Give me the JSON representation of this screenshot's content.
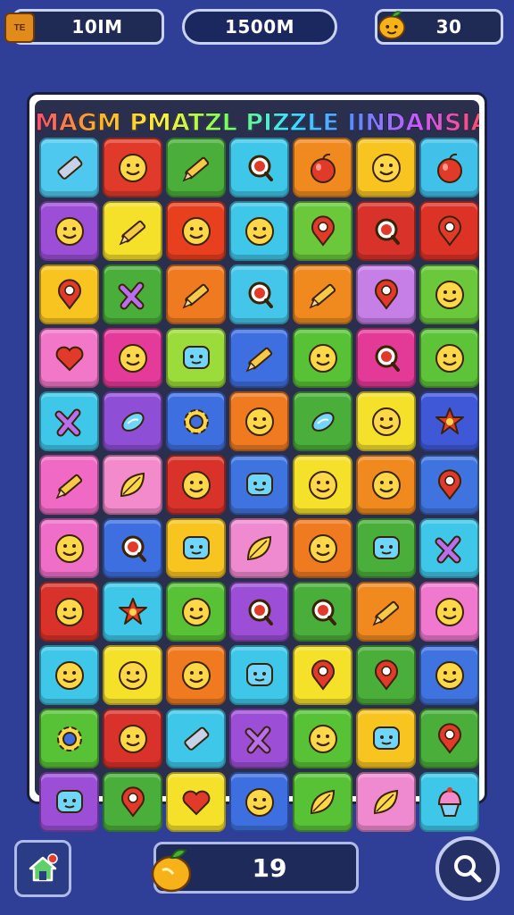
{
  "hud": {
    "left_value": "10IM",
    "center_value": "1500M",
    "right_value": "30",
    "chest_label": "TE",
    "left_icon": "treasure-chest-icon",
    "right_icon": "fruit-icon"
  },
  "board": {
    "title": "MAGM PMATZL PIZZLE IINDANSIA!",
    "tiles": [
      {
        "color": "#4fc8ef",
        "icon": "eraser"
      },
      {
        "color": "#e23a2a",
        "icon": "face"
      },
      {
        "color": "#4aae3a",
        "icon": "pencil"
      },
      {
        "color": "#3ec7e8",
        "icon": "search"
      },
      {
        "color": "#f08a1e",
        "icon": "apple"
      },
      {
        "color": "#f8c520",
        "icon": "face"
      },
      {
        "color": "#3fc1ea",
        "icon": "apple"
      },
      {
        "color": "#9c4fd6",
        "icon": "face"
      },
      {
        "color": "#f5e02a",
        "icon": "pencil"
      },
      {
        "color": "#e8401f",
        "icon": "face"
      },
      {
        "color": "#3ec7e8",
        "icon": "face"
      },
      {
        "color": "#6ac83a",
        "icon": "pin"
      },
      {
        "color": "#d8322a",
        "icon": "search"
      },
      {
        "color": "#dd3326",
        "icon": "pin"
      },
      {
        "color": "#f8c520",
        "icon": "pin"
      },
      {
        "color": "#4aae3a",
        "icon": "cross"
      },
      {
        "color": "#ef7a20",
        "icon": "pencil"
      },
      {
        "color": "#44c6ea",
        "icon": "search"
      },
      {
        "color": "#f08a1e",
        "icon": "pencil"
      },
      {
        "color": "#c77fe8",
        "icon": "pin"
      },
      {
        "color": "#6ac83a",
        "icon": "face"
      },
      {
        "color": "#f277c9",
        "icon": "heart"
      },
      {
        "color": "#e43a9a",
        "icon": "face"
      },
      {
        "color": "#9bdc3a",
        "icon": "bubble"
      },
      {
        "color": "#3e6fe0",
        "icon": "pencil"
      },
      {
        "color": "#58c236",
        "icon": "face"
      },
      {
        "color": "#e33a98",
        "icon": "search"
      },
      {
        "color": "#5dc43a",
        "icon": "face"
      },
      {
        "color": "#3ec7e8",
        "icon": "cross"
      },
      {
        "color": "#8e4fd6",
        "icon": "candy"
      },
      {
        "color": "#3e6fe0",
        "icon": "gear"
      },
      {
        "color": "#ef7a20",
        "icon": "face"
      },
      {
        "color": "#4aae3a",
        "icon": "candy"
      },
      {
        "color": "#f5e02a",
        "icon": "face"
      },
      {
        "color": "#3f58d8",
        "icon": "star"
      },
      {
        "color": "#f06ac5",
        "icon": "pencil"
      },
      {
        "color": "#f28acb",
        "icon": "leaf"
      },
      {
        "color": "#d8322a",
        "icon": "face"
      },
      {
        "color": "#3f74e0",
        "icon": "bubble"
      },
      {
        "color": "#f5e02a",
        "icon": "face"
      },
      {
        "color": "#f08a1e",
        "icon": "face"
      },
      {
        "color": "#3f74e0",
        "icon": "pin"
      },
      {
        "color": "#ef6fc8",
        "icon": "face"
      },
      {
        "color": "#3e6fe0",
        "icon": "search"
      },
      {
        "color": "#f8c520",
        "icon": "bubble"
      },
      {
        "color": "#f08ad0",
        "icon": "leaf"
      },
      {
        "color": "#ef7a20",
        "icon": "face"
      },
      {
        "color": "#4aae3a",
        "icon": "bubble"
      },
      {
        "color": "#3ec7e8",
        "icon": "cross"
      },
      {
        "color": "#d8322a",
        "icon": "face"
      },
      {
        "color": "#3ec7e8",
        "icon": "star"
      },
      {
        "color": "#58c236",
        "icon": "face"
      },
      {
        "color": "#9c4fd6",
        "icon": "search"
      },
      {
        "color": "#4aae3a",
        "icon": "search"
      },
      {
        "color": "#f08a1e",
        "icon": "pencil"
      },
      {
        "color": "#f078cf",
        "icon": "face"
      },
      {
        "color": "#3ec7e8",
        "icon": "face"
      },
      {
        "color": "#f5e02a",
        "icon": "face"
      },
      {
        "color": "#ef7a20",
        "icon": "face"
      },
      {
        "color": "#3ec7e8",
        "icon": "bubble"
      },
      {
        "color": "#f5e02a",
        "icon": "pin"
      },
      {
        "color": "#4aae3a",
        "icon": "pin"
      },
      {
        "color": "#3f74e0",
        "icon": "face"
      },
      {
        "color": "#58c236",
        "icon": "gear"
      },
      {
        "color": "#d8322a",
        "icon": "face"
      },
      {
        "color": "#3ec7e8",
        "icon": "eraser"
      },
      {
        "color": "#9c4fd6",
        "icon": "cross"
      },
      {
        "color": "#58c236",
        "icon": "face"
      },
      {
        "color": "#f8c520",
        "icon": "bubble"
      },
      {
        "color": "#4aae3a",
        "icon": "pin"
      },
      {
        "color": "#9c4fd6",
        "icon": "bubble"
      },
      {
        "color": "#4aae3a",
        "icon": "pin"
      },
      {
        "color": "#f5e02a",
        "icon": "heart"
      },
      {
        "color": "#3e6fe0",
        "icon": "face"
      },
      {
        "color": "#58c236",
        "icon": "leaf"
      },
      {
        "color": "#f08ad0",
        "icon": "leaf"
      },
      {
        "color": "#3ec7e8",
        "icon": "cupcake"
      }
    ]
  },
  "footer": {
    "score_value": "19",
    "home_icon": "home-icon",
    "search_icon": "search-icon",
    "fruit_icon": "fruit-icon"
  }
}
